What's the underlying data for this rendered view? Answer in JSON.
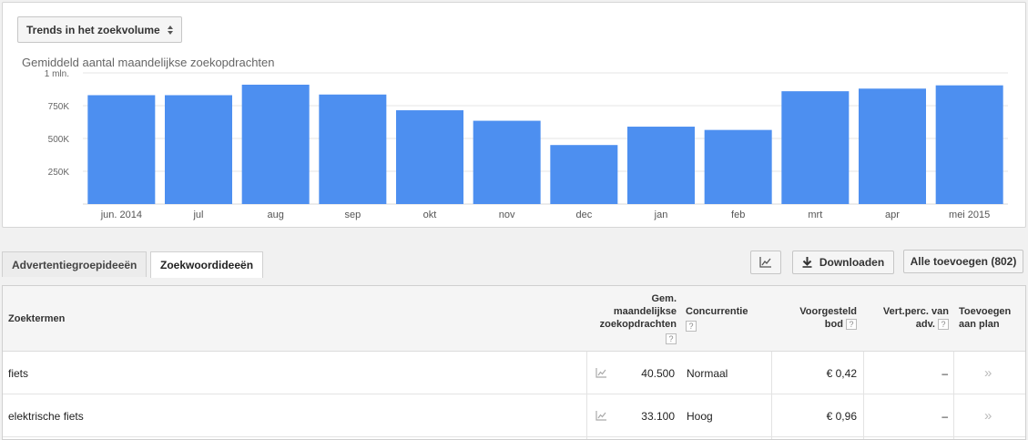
{
  "chart_panel": {
    "selector_label": "Trends in het zoekvolume",
    "title": "Gemiddeld aantal maandelijkse zoekopdrachten"
  },
  "chart_data": {
    "type": "bar",
    "categories": [
      "jun. 2014",
      "jul",
      "aug",
      "sep",
      "okt",
      "nov",
      "dec",
      "jan",
      "feb",
      "mrt",
      "apr",
      "mei 2015"
    ],
    "values": [
      830000,
      830000,
      910000,
      835000,
      715000,
      635000,
      450000,
      590000,
      565000,
      860000,
      880000,
      905000
    ],
    "y_ticks": [
      {
        "value": 250000,
        "label": "250K"
      },
      {
        "value": 500000,
        "label": "500K"
      },
      {
        "value": 750000,
        "label": "750K"
      },
      {
        "value": 1000000,
        "label": "1 mln."
      }
    ],
    "ylim": [
      0,
      1000000
    ],
    "bar_color": "#4d8ff0",
    "grid": true
  },
  "tabs": [
    {
      "label": "Advertentiegroepideeën",
      "active": false
    },
    {
      "label": "Zoekwoordideeën",
      "active": true
    }
  ],
  "toolbar": {
    "chart_icon": "line-chart-icon",
    "download_label": "Downloaden",
    "add_all_label": "Alle toevoegen (802)"
  },
  "table": {
    "headers": {
      "term": "Zoektermen",
      "volume": [
        "Gem.",
        "maandelijkse",
        "zoekopdrachten"
      ],
      "competition": "Concurrentie",
      "bid": [
        "Voorgesteld",
        "bod"
      ],
      "impr_share": [
        "Vert.perc. van",
        "adv."
      ],
      "add": [
        "Toevoegen",
        "aan plan"
      ]
    },
    "help_mark": "?",
    "rows": [
      {
        "term": "fiets",
        "volume": "40.500",
        "competition": "Normaal",
        "bid": "€ 0,42",
        "impr_share": "–",
        "add": "»"
      },
      {
        "term": "elektrische fiets",
        "volume": "33.100",
        "competition": "Hoog",
        "bid": "€ 0,96",
        "impr_share": "–",
        "add": "»"
      }
    ]
  }
}
